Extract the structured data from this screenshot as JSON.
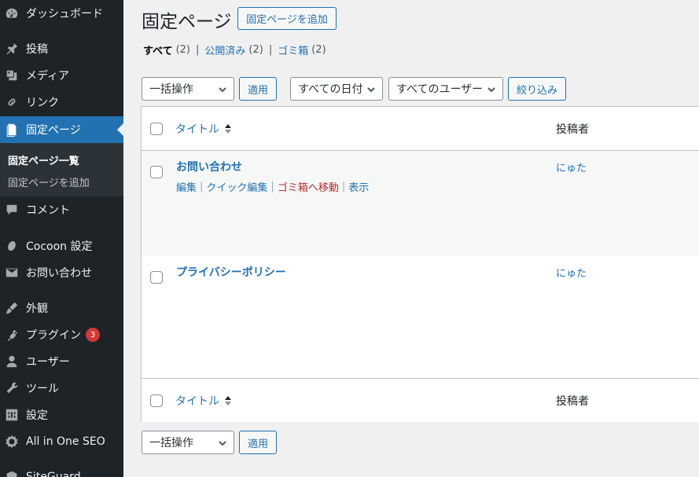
{
  "sidebar": {
    "items": [
      {
        "label": "ダッシュボード",
        "icon": "dashboard-icon"
      },
      {
        "label": "投稿",
        "icon": "pin-icon"
      },
      {
        "label": "メディア",
        "icon": "media-icon"
      },
      {
        "label": "リンク",
        "icon": "link-icon"
      },
      {
        "label": "固定ページ",
        "icon": "page-icon"
      },
      {
        "label": "コメント",
        "icon": "comment-icon"
      },
      {
        "label": "Cocoon 設定",
        "icon": "cocoon-icon"
      },
      {
        "label": "お問い合わせ",
        "icon": "mail-icon"
      },
      {
        "label": "外観",
        "icon": "brush-icon"
      },
      {
        "label": "プラグイン",
        "icon": "plugin-icon",
        "badge": "3"
      },
      {
        "label": "ユーザー",
        "icon": "user-icon"
      },
      {
        "label": "ツール",
        "icon": "wrench-icon"
      },
      {
        "label": "設定",
        "icon": "settings-icon"
      },
      {
        "label": "All in One SEO",
        "icon": "gear-icon"
      },
      {
        "label": "SiteGuard",
        "icon": "shield-icon"
      }
    ],
    "submenu": [
      {
        "label": "固定ページ一覧"
      },
      {
        "label": "固定ページを追加"
      }
    ]
  },
  "header": {
    "title": "固定ページ",
    "add_button": "固定ページを追加"
  },
  "filters": {
    "all_label": "すべて",
    "all_count": "(2)",
    "published_label": "公開済み",
    "published_count": "(2)",
    "trash_label": "ゴミ箱",
    "trash_count": "(2)"
  },
  "toolbar": {
    "bulk_action": "一括操作",
    "apply": "適用",
    "date_filter": "すべての日付",
    "user_filter": "すべてのユーザー",
    "filter_button": "絞り込み"
  },
  "table": {
    "col_title": "タイトル",
    "col_author": "投稿者",
    "rows": [
      {
        "title": "お問い合わせ",
        "author": "にゅた",
        "actions": {
          "edit": "編集",
          "quick_edit": "クイック編集",
          "trash": "ゴミ箱へ移動",
          "view": "表示"
        }
      },
      {
        "title": "プライバシーポリシー",
        "author": "にゅた"
      }
    ]
  },
  "bottom_toolbar": {
    "bulk_action": "一括操作",
    "apply": "適用"
  },
  "colors": {
    "sidebar_bg": "#1d2327",
    "accent": "#2271b1",
    "trash_red": "#b32d2e",
    "badge_red": "#d63638"
  }
}
